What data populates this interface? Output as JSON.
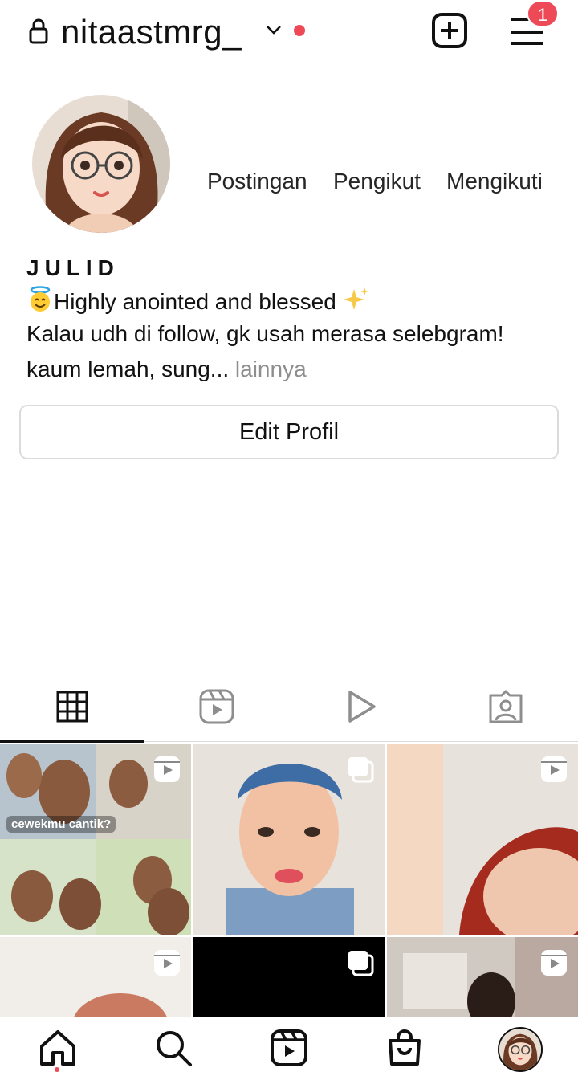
{
  "header": {
    "username": "nitaastmrg_",
    "notification_count": "1",
    "icons": [
      "lock-icon",
      "chevron-down-icon",
      "new-post-icon",
      "menu-icon"
    ]
  },
  "profile": {
    "stats": [
      {
        "label": "Postingan"
      },
      {
        "label": "Pengikut"
      },
      {
        "label": "Mengikuti"
      }
    ],
    "display_name": "JULID",
    "bio_line1": "Highly anointed and blessed",
    "bio_line2": "Kalau udh di follow, gk usah merasa selebgram!",
    "bio_line3": "kaum lemah, sung...",
    "bio_more": "lainnya",
    "edit_button": "Edit Profil"
  },
  "tabs": [
    {
      "name": "posts-grid-icon",
      "active": true
    },
    {
      "name": "reels-icon",
      "active": false
    },
    {
      "name": "video-icon",
      "active": false
    },
    {
      "name": "tagged-icon",
      "active": false
    }
  ],
  "grid": {
    "cells": [
      {
        "type": "reel",
        "caption": "cewekmu cantik?"
      },
      {
        "type": "carousel",
        "caption": ""
      },
      {
        "type": "reel",
        "caption": ""
      },
      {
        "type": "reel",
        "caption": ""
      },
      {
        "type": "carousel",
        "caption": ""
      },
      {
        "type": "reel",
        "caption": ""
      }
    ]
  },
  "bottom_nav": [
    "home-icon",
    "search-icon",
    "reels-icon",
    "shop-icon",
    "profile-avatar"
  ],
  "colors": {
    "accent_red": "#ed4956",
    "border": "#dbdbdb",
    "muted": "#8e8e8e"
  }
}
